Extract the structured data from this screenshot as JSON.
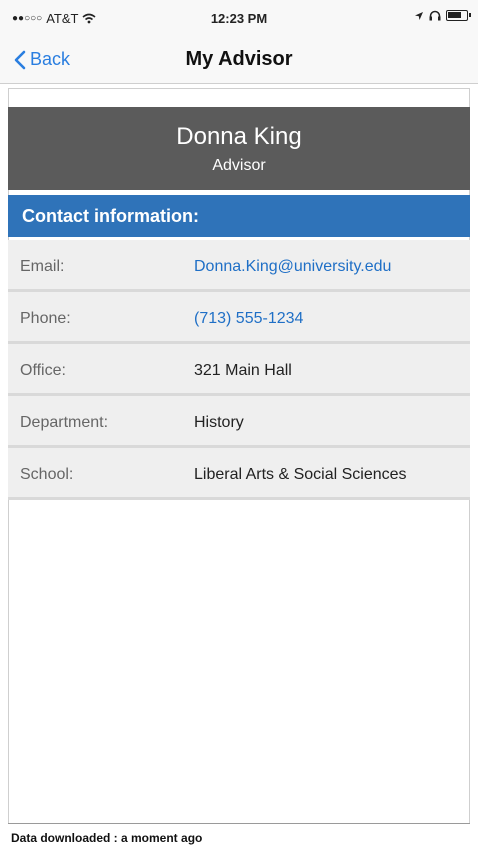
{
  "status": {
    "carrier": "AT&T",
    "time": "12:23 PM"
  },
  "nav": {
    "back_label": "Back",
    "title": "My Advisor"
  },
  "advisor": {
    "name": "Donna King",
    "role": "Advisor"
  },
  "contact": {
    "heading": "Contact information:",
    "rows": [
      {
        "label": "Email:",
        "value": "Donna.King@university.edu"
      },
      {
        "label": "Phone:",
        "value": "(713) 555-1234"
      },
      {
        "label": "Office:",
        "value": "321 Main Hall"
      },
      {
        "label": "Department:",
        "value": "History"
      },
      {
        "label": "School:",
        "value": "Liberal Arts & Social Sciences"
      }
    ]
  },
  "footer": {
    "text": "Data downloaded : a moment ago"
  },
  "colors": {
    "accent": "#2f73b9",
    "header_bg": "#5b5b5b",
    "link": "#1f6fc6",
    "back": "#2a7ee0"
  }
}
